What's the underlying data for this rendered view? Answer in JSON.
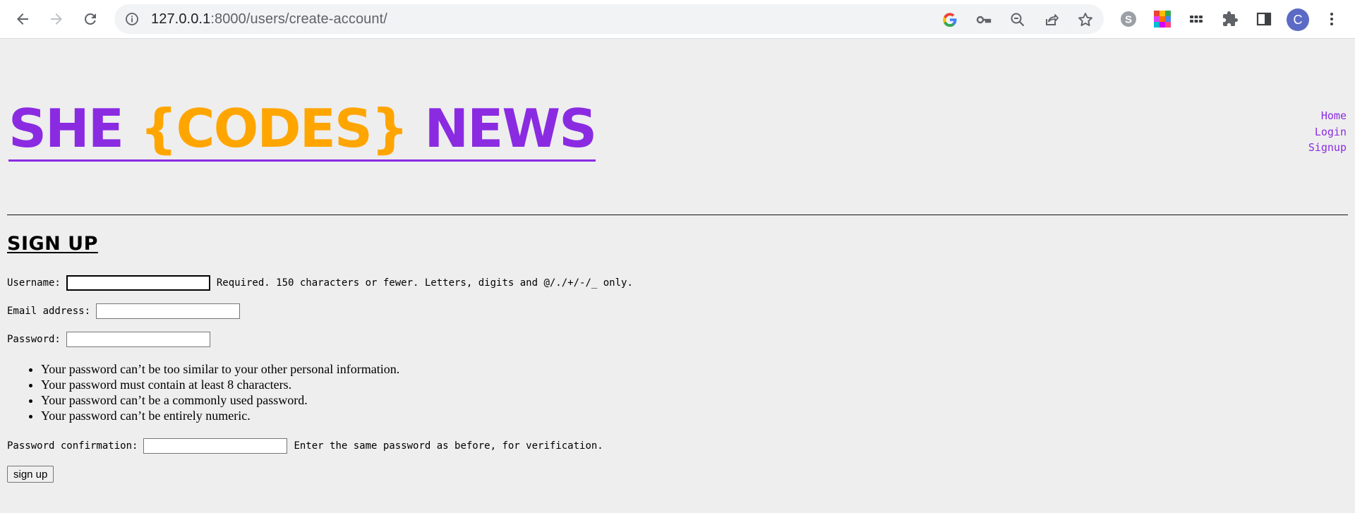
{
  "browser": {
    "url_host": "127.0.0.1",
    "url_path": ":8000/users/create-account/",
    "profile_initial": "C"
  },
  "site": {
    "logo_part1": "SHE ",
    "logo_part2": "{CODES}",
    "logo_part3": " NEWS",
    "brand_color": "#8a2be2",
    "accent_color": "#ffa500",
    "nav": [
      {
        "label": "Home"
      },
      {
        "label": "Login"
      },
      {
        "label": "Signup"
      }
    ]
  },
  "page": {
    "title": "SIGN UP",
    "username_label": "Username:",
    "username_help": "Required. 150 characters or fewer. Letters, digits and @/./+/-/_ only.",
    "email_label": "Email address:",
    "password_label": "Password:",
    "password_rules": [
      "Your password can’t be too similar to your other personal information.",
      "Your password must contain at least 8 characters.",
      "Your password can’t be a commonly used password.",
      "Your password can’t be entirely numeric."
    ],
    "confirm_label": "Password confirmation:",
    "confirm_help": "Enter the same password as before, for verification.",
    "submit_label": "sign up"
  }
}
